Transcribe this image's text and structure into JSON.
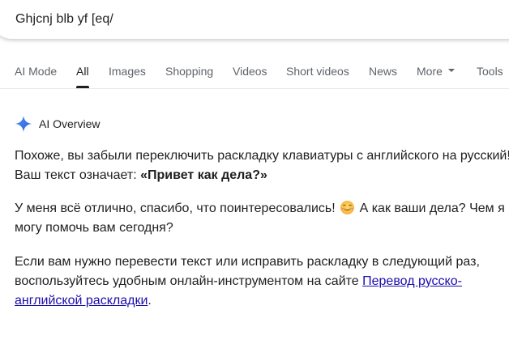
{
  "search": {
    "query": "Ghjcnj blb yf [eq/"
  },
  "tabs": [
    {
      "label": "AI Mode"
    },
    {
      "label": "All"
    },
    {
      "label": "Images"
    },
    {
      "label": "Shopping"
    },
    {
      "label": "Videos"
    },
    {
      "label": "Short videos"
    },
    {
      "label": "News"
    },
    {
      "label": "More"
    },
    {
      "label": "Tools"
    }
  ],
  "ai_overview": {
    "title": "AI Overview",
    "p1_line1": "Похоже, вы забыли переключить раскладку клавиатуры с английского на русский!",
    "p1_line2_prefix": "Ваш текст означает: ",
    "p1_line2_bold": "«Привет как дела?»",
    "p2_line1_a": "У меня всё отлично, спасибо, что поинтересовались! ",
    "p2_line1_b": " А как ваши дела? Чем я",
    "p2_line2": "могу помочь вам сегодня?",
    "p3_line1": "Если вам нужно перевести текст или исправить раскладку в следующий раз,",
    "p3_line2_prefix": "воспользуйтесь удобным онлайн-инструментом на сайте ",
    "p3_link_part1": "Перевод русско-",
    "p3_link_part2": "английской раскладки",
    "p3_line3_suffix": "."
  },
  "icons": {
    "ai_sparkle": "sparkle-icon",
    "emoji": "smiling-face-icon",
    "more_caret": "caret-down-icon"
  },
  "colors": {
    "link": "#1a0dab",
    "sparkle": "#4285f4"
  }
}
